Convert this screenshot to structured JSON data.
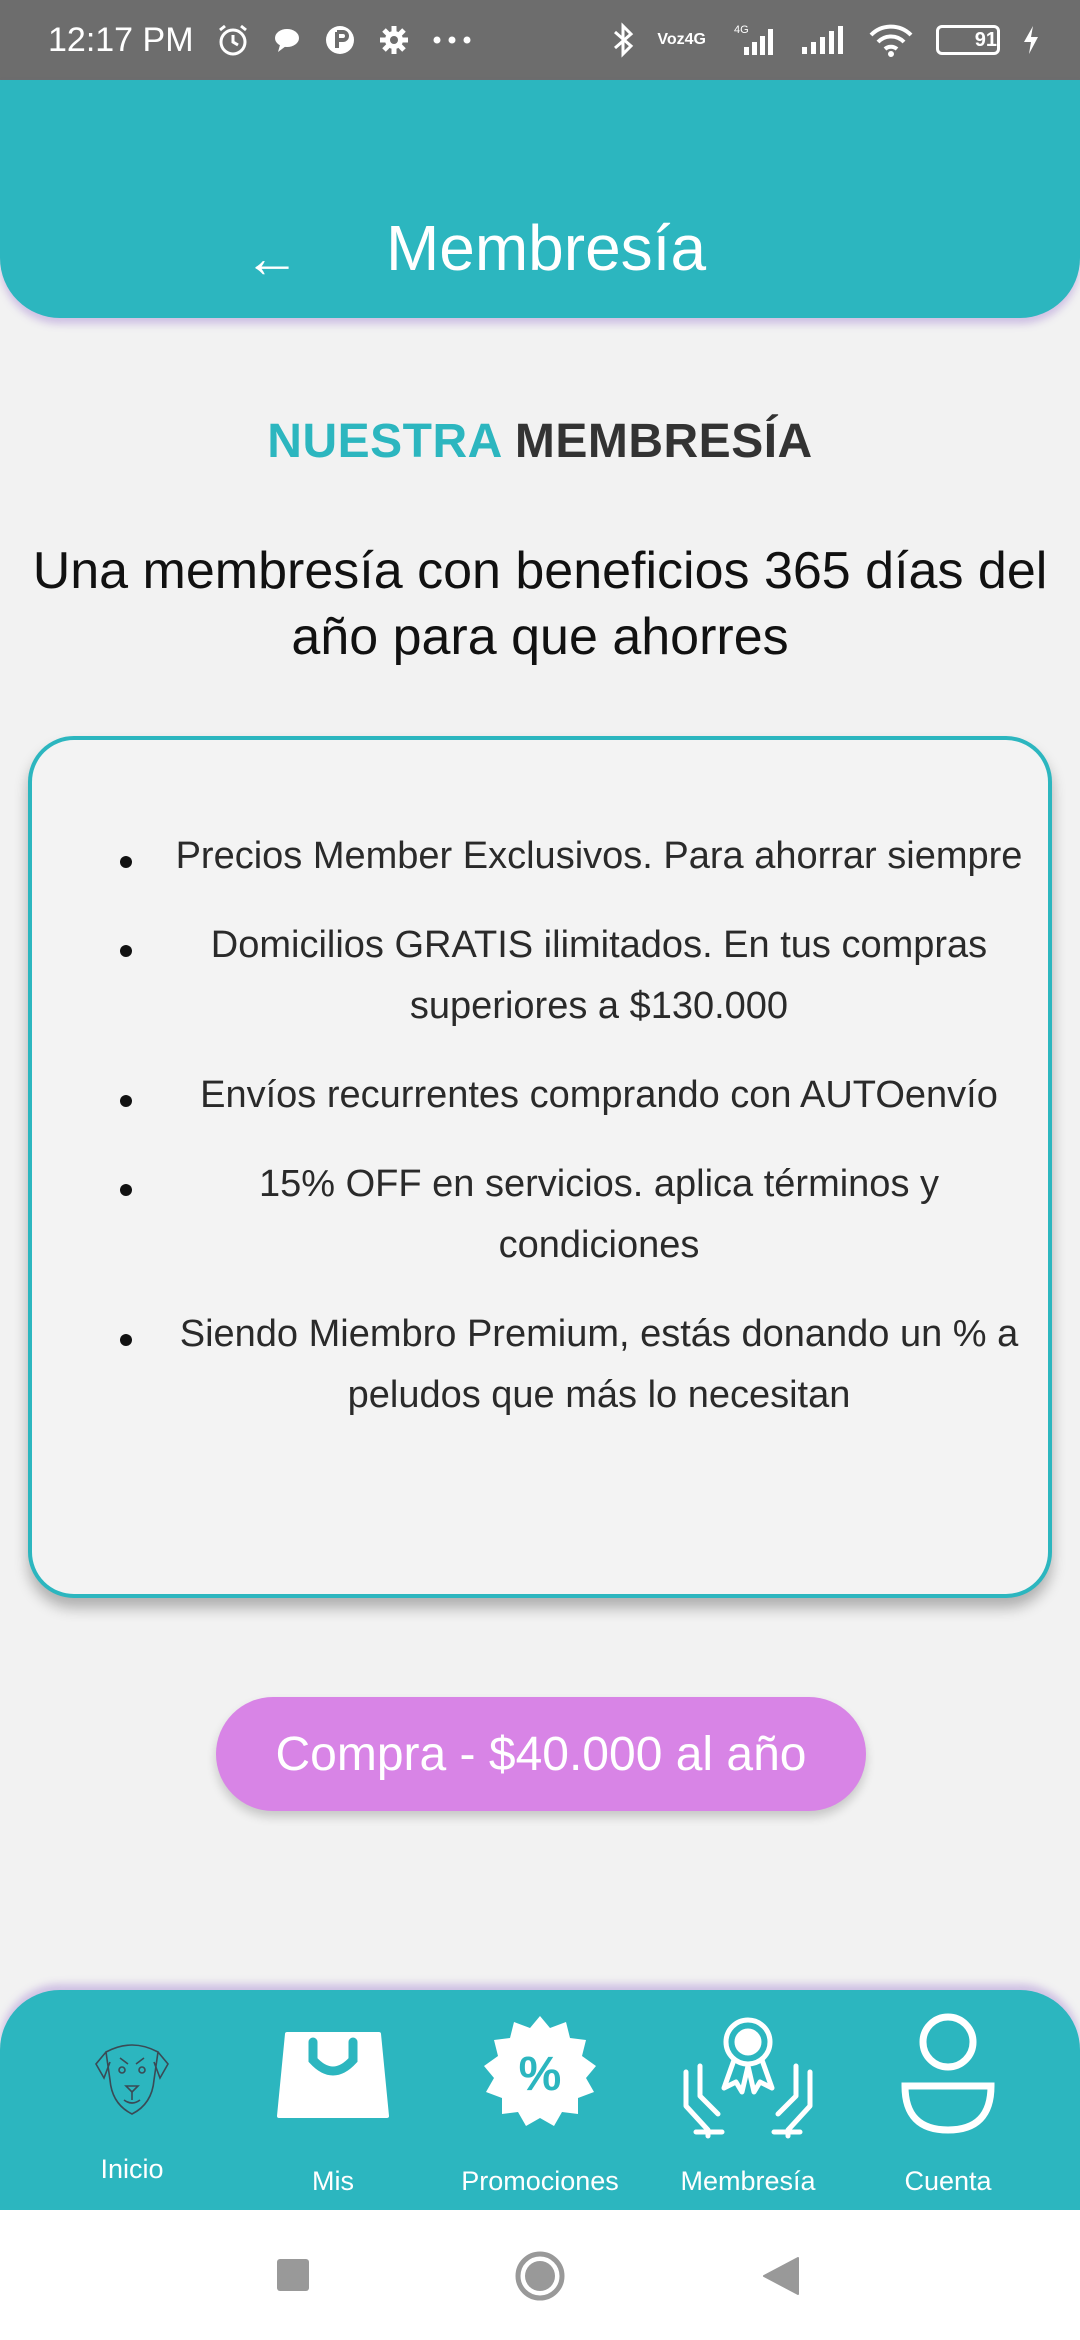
{
  "status_bar": {
    "time": "12:17 PM",
    "voz_label": "Voz",
    "network_label": "4G",
    "signal_label": "4G",
    "battery_level": "91"
  },
  "header": {
    "back_icon": "←",
    "title": "Membresía"
  },
  "section": {
    "heading_accent": "NUESTRA",
    "heading_main": "MEMBRESÍA",
    "subtitle": "Una membresía con beneficios 365 días del año para que ahorres"
  },
  "benefits": [
    {
      "text": "Precios Member Exclusivos. Para ahorrar siempre"
    },
    {
      "text": "Domicilios GRATIS ilimitados. En tus compras superiores a $130.000"
    },
    {
      "text": "Envíos recurrentes comprando con AUTOenvío"
    },
    {
      "text": "15% OFF en servicios. aplica términos y condiciones"
    },
    {
      "text": "Siendo Miembro Premium, estás donando un % a peludos que más lo necesitan"
    }
  ],
  "buy_button": {
    "label": "Compra - $40.000 al año"
  },
  "bottom_nav": {
    "items": [
      {
        "label": "Inicio",
        "icon": "dog-icon"
      },
      {
        "label": "Mis",
        "icon": "shopping-bag-icon"
      },
      {
        "label": "Promociones",
        "icon": "discount-badge-icon"
      },
      {
        "label": "Membresía",
        "icon": "award-hands-icon"
      },
      {
        "label": "Cuenta",
        "icon": "user-icon"
      }
    ]
  },
  "colors": {
    "accent": "#2cb6bf",
    "button": "#d884e6",
    "background": "#f2f2f2"
  }
}
